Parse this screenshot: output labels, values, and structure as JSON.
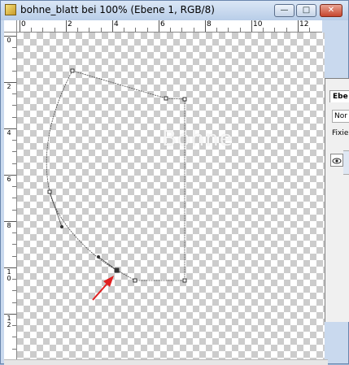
{
  "window": {
    "title": "bohne_blatt bei 100% (Ebene 1, RGB/8)",
    "buttons": {
      "minimize": "—",
      "maximize": "□",
      "close": "✕"
    }
  },
  "rulers": {
    "top_labels": [
      "0",
      "2",
      "4",
      "6",
      "8",
      "10",
      "12"
    ],
    "left_labels": [
      "0",
      "2",
      "4",
      "6",
      "8",
      "10",
      "12"
    ]
  },
  "canvas": {
    "watermark": "Bohne",
    "colors": {
      "arrow": "#e02020",
      "path": "#444444"
    }
  },
  "layers_panel": {
    "tab_label": "Ebe",
    "blend_mode": "Nor",
    "lock_label": "Fixier",
    "icons": [
      "eye-icon"
    ]
  }
}
